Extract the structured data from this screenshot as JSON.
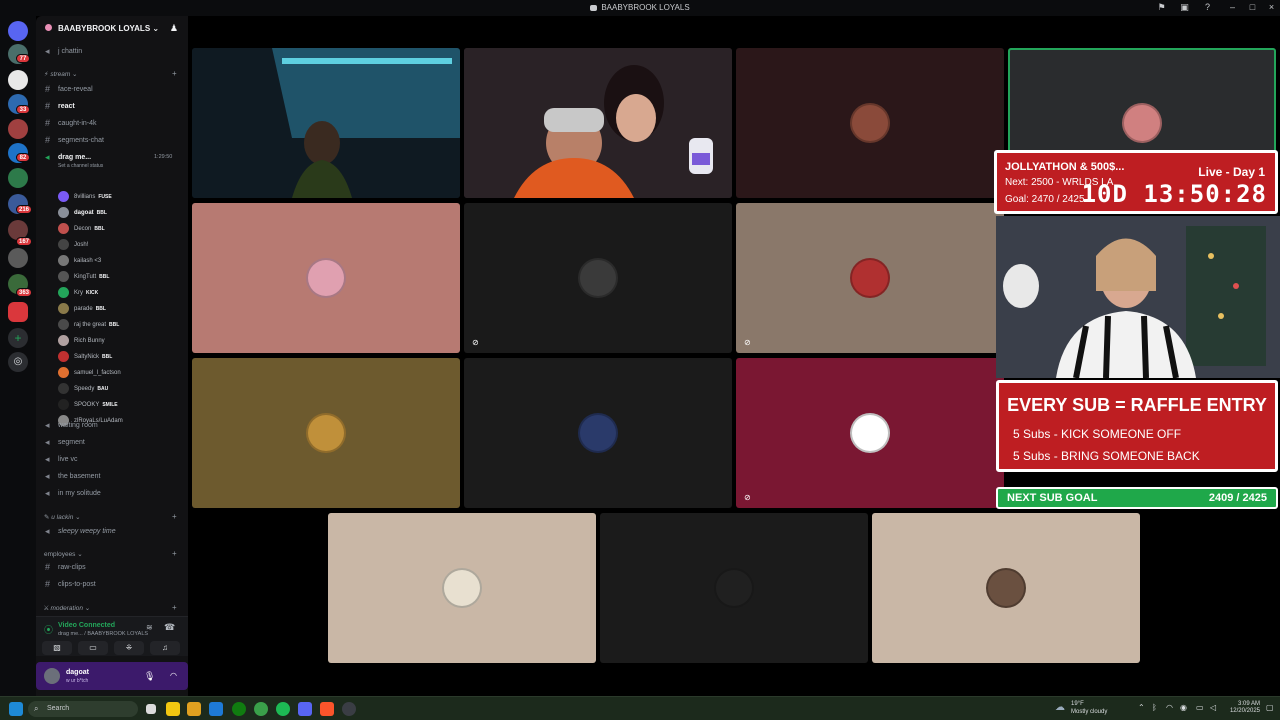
{
  "window": {
    "title": "BAABYBROOK LOYALS"
  },
  "server": {
    "name": "BAABYBROOK LOYALS",
    "name_with_caret": "BAABYBROOK LOYALS ⌄"
  },
  "guild_badges": [
    "77",
    "33",
    "82",
    "216",
    "167",
    "363",
    "27"
  ],
  "channels_top": [
    {
      "label": "j chattin",
      "icon": "voice-icon"
    }
  ],
  "category_stream": "stream",
  "stream_channels": [
    {
      "label": "face-reveal"
    },
    {
      "label": "react",
      "active": true
    },
    {
      "label": "caught-in-4k"
    },
    {
      "label": "segments-chat"
    }
  ],
  "voice_active": {
    "label": "drag me...",
    "timer": "1:29:50",
    "status": "Set a channel status"
  },
  "voice_users": [
    {
      "name": "8villians",
      "tag": "FUSE",
      "color": "#7a5af5"
    },
    {
      "name": "dagoat",
      "tag": "BBL",
      "color": "#8a8f99",
      "bold": true
    },
    {
      "name": "Decon",
      "tag": "BBL",
      "color": "#c0504d"
    },
    {
      "name": "Josh!",
      "tag": "",
      "color": "#444"
    },
    {
      "name": "kailash <3",
      "tag": "",
      "color": "#777"
    },
    {
      "name": "KingTutt",
      "tag": "BBL",
      "color": "#555"
    },
    {
      "name": "Kry",
      "tag": "KICK",
      "color": "#23a55a"
    },
    {
      "name": "parade",
      "tag": "BBL",
      "color": "#8a7a4a"
    },
    {
      "name": "raj the great",
      "tag": "BBL",
      "color": "#4a4a4a"
    },
    {
      "name": "Rich Bunny",
      "tag": "",
      "color": "#b0a0a0"
    },
    {
      "name": "SaltyNick",
      "tag": "BBL",
      "color": "#c03030"
    },
    {
      "name": "samuel_l_factson",
      "tag": "",
      "color": "#e07030"
    },
    {
      "name": "Speedy",
      "tag": "BAU",
      "color": "#333"
    },
    {
      "name": "SPOOKY",
      "tag": "SMILE",
      "color": "#222"
    },
    {
      "name": "zlRoyaLs/LuAdam",
      "tag": "",
      "color": "#888"
    }
  ],
  "voice_channels": [
    {
      "label": "waiting room"
    },
    {
      "label": "segment"
    },
    {
      "label": "live vc"
    },
    {
      "label": "the basement"
    },
    {
      "label": "in my solitude"
    }
  ],
  "category_slackin": "u lackin",
  "slackin_channel": "sleepy weepy time",
  "category_employees": "employees",
  "employee_channels": [
    {
      "label": "raw-clips"
    },
    {
      "label": "clips-to-post"
    }
  ],
  "category_moderation": "moderation",
  "voice_panel": {
    "status": "Video Connected",
    "location": "drag me... / BAABYBROOK LOYALS"
  },
  "user": {
    "name": "dagoat",
    "status": "w ur b*tch"
  },
  "overlay": {
    "timer_title": "JOLLYATHON & 500$...",
    "timer_next": "Next: 2500 - WRLDS LA",
    "timer_goal": "Goal: 2470 / 2425",
    "live_label": "Live - Day 1",
    "clock": "10D 13:50:28",
    "raffle_head": "EVERY SUB = RAFFLE ENTRY",
    "raffle_l1": "5 Subs - KICK SOMEONE OFF",
    "raffle_l2": "5 Subs - BRING SOMEONE BACK",
    "goal_label": "NEXT SUB GOAL",
    "goal_value": "2409 / 2425"
  },
  "tiles": [
    {
      "bg": "#0f1a22",
      "kind": "cam"
    },
    {
      "bg": "#2a2226",
      "kind": "cam"
    },
    {
      "bg": "#2b1719",
      "kind": "avatar",
      "av": "#8a4a3a"
    },
    {
      "bg": "#2a2c2e",
      "kind": "avatar",
      "av": "#d08080",
      "speaking": true
    },
    {
      "bg": "#b77a72",
      "kind": "avatar",
      "av": "#e0a0b0"
    },
    {
      "bg": "#1a1a1a",
      "kind": "avatar",
      "av": "#3a3a3a",
      "muted": true
    },
    {
      "bg": "#8a786a",
      "kind": "avatar",
      "av": "#b03030",
      "muted": true
    },
    {
      "bg": "#6d5a2e",
      "kind": "avatar",
      "av": "#c0903a"
    },
    {
      "bg": "#1b1b1b",
      "kind": "avatar",
      "av": "#2a3a6a"
    },
    {
      "bg": "#7a1732",
      "kind": "avatar",
      "av": "#ffffff",
      "muted": true
    },
    {
      "bg": "#c9b7a6",
      "kind": "avatar",
      "av": "#e8e0d0"
    },
    {
      "bg": "#1b1b1b",
      "kind": "avatar",
      "av": "#202020"
    },
    {
      "bg": "#c9b7a6",
      "kind": "avatar",
      "av": "#6a5040"
    }
  ],
  "taskbar": {
    "search": "Search",
    "temp": "19°F",
    "weather": "Mostly cloudy",
    "time": "3:09 AM",
    "date": "12/20/2025"
  }
}
